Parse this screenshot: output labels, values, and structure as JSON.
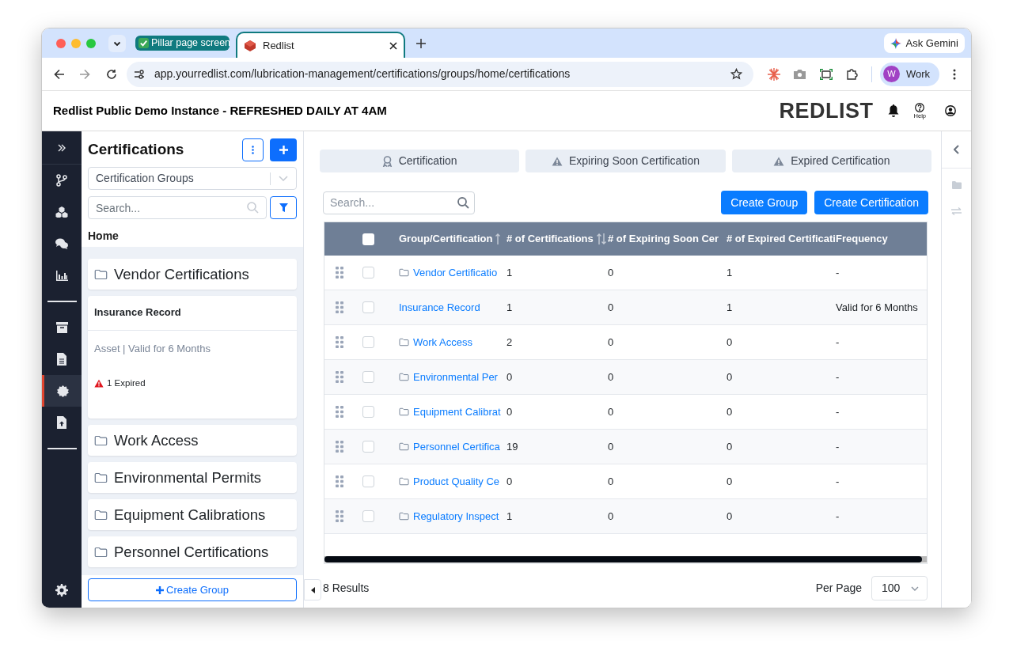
{
  "browser": {
    "tabs": [
      {
        "kind": "group",
        "title": "Pillar page screen",
        "selected": false
      },
      {
        "kind": "page",
        "title": "Redlist",
        "selected": true
      }
    ],
    "url": "app.yourredlist.com/lubrication-management/certifications/groups/home/certifications",
    "ask": "Ask Gemini",
    "profile": {
      "initial": "W",
      "name": "Work"
    }
  },
  "app": {
    "title": "Redlist Public Demo Instance - REFRESHED DAILY AT 4AM",
    "logo": "REDLIST",
    "help": "Help"
  },
  "nav": [
    {
      "kind": "expand",
      "selected": false
    },
    {
      "kind": "branch",
      "selected": false
    },
    {
      "kind": "cubes",
      "selected": false
    },
    {
      "kind": "chat",
      "selected": false
    },
    {
      "kind": "chart",
      "selected": false
    },
    {
      "kind": "divider"
    },
    {
      "kind": "archive",
      "selected": false
    },
    {
      "kind": "document",
      "selected": false
    },
    {
      "kind": "badge",
      "selected": true
    },
    {
      "kind": "upload",
      "selected": false
    },
    {
      "kind": "divider"
    },
    {
      "kind": "settings",
      "selected": false
    }
  ],
  "sidebar": {
    "title": "Certifications",
    "group_select": "Certification Groups",
    "search_placeholder": "Search...",
    "breadcrumb": "Home",
    "cards": [
      {
        "kind": "folder",
        "name": "Vendor Certifications"
      },
      {
        "kind": "certificate",
        "name": "Insurance Record",
        "details": "Asset | Valid for 6 Months",
        "alert": "1 Expired"
      },
      {
        "kind": "folder",
        "name": "Work Access"
      },
      {
        "kind": "folder",
        "name": "Environmental Permits"
      },
      {
        "kind": "folder",
        "name": "Equipment Calibrations"
      },
      {
        "kind": "folder",
        "name": "Personnel Certifications"
      }
    ],
    "create_button": "Create Group"
  },
  "main": {
    "tabs": [
      {
        "kind": "certificate",
        "label": "Certification"
      },
      {
        "kind": "warning",
        "label": "Expiring Soon Certification"
      },
      {
        "kind": "warning",
        "label": "Expired Certification"
      }
    ],
    "search_placeholder": "Search...",
    "buttons": [
      "Create Group",
      "Create Certification"
    ],
    "table": {
      "all_selected": false,
      "columns": [
        {
          "label": "Group/Certification",
          "sortable": true,
          "sorted": true
        },
        {
          "label": "# of Certifications",
          "sortable": true,
          "sorted": false
        },
        {
          "label": "# of Expiring Soon Cer",
          "sortable": false
        },
        {
          "label": "# of Expired Certificati",
          "sortable": false
        },
        {
          "label": "Frequency",
          "sortable": false
        }
      ],
      "rows": [
        {
          "kind": "folder",
          "name": "Vendor Certificatio",
          "certifications": "1",
          "expiring_soon": "0",
          "expired": "1",
          "frequency": "-",
          "selected": false
        },
        {
          "kind": "certificate",
          "name": "Insurance Record",
          "certifications": "1",
          "expiring_soon": "0",
          "expired": "1",
          "frequency": "Valid for 6 Months",
          "selected": false
        },
        {
          "kind": "folder",
          "name": "Work Access",
          "certifications": "2",
          "expiring_soon": "0",
          "expired": "0",
          "frequency": "-",
          "selected": false
        },
        {
          "kind": "folder",
          "name": "Environmental Per",
          "certifications": "0",
          "expiring_soon": "0",
          "expired": "0",
          "frequency": "-",
          "selected": false
        },
        {
          "kind": "folder",
          "name": "Equipment Calibrat",
          "certifications": "0",
          "expiring_soon": "0",
          "expired": "0",
          "frequency": "-",
          "selected": false
        },
        {
          "kind": "folder",
          "name": "Personnel Certifica",
          "certifications": "19",
          "expiring_soon": "0",
          "expired": "0",
          "frequency": "-",
          "selected": false
        },
        {
          "kind": "folder",
          "name": "Product Quality Ce",
          "certifications": "0",
          "expiring_soon": "0",
          "expired": "0",
          "frequency": "-",
          "selected": false
        },
        {
          "kind": "folder",
          "name": "Regulatory Inspect",
          "certifications": "1",
          "expiring_soon": "0",
          "expired": "0",
          "frequency": "-",
          "selected": false
        }
      ]
    },
    "footer": {
      "results": "8 Results",
      "per_page_label": "Per Page",
      "per_page": "100"
    }
  }
}
